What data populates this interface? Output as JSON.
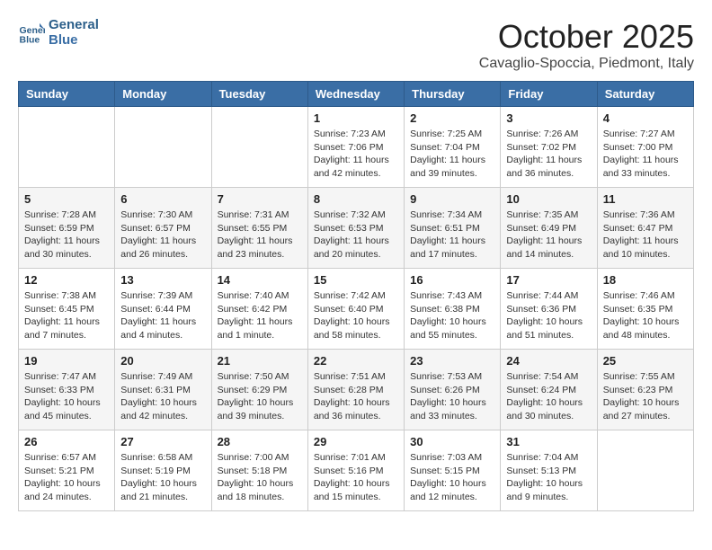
{
  "header": {
    "logo_line1": "General",
    "logo_line2": "Blue",
    "month_title": "October 2025",
    "location": "Cavaglio-Spoccia, Piedmont, Italy"
  },
  "weekdays": [
    "Sunday",
    "Monday",
    "Tuesday",
    "Wednesday",
    "Thursday",
    "Friday",
    "Saturday"
  ],
  "weeks": [
    [
      {
        "day": "",
        "info": ""
      },
      {
        "day": "",
        "info": ""
      },
      {
        "day": "",
        "info": ""
      },
      {
        "day": "1",
        "info": "Sunrise: 7:23 AM\nSunset: 7:06 PM\nDaylight: 11 hours\nand 42 minutes."
      },
      {
        "day": "2",
        "info": "Sunrise: 7:25 AM\nSunset: 7:04 PM\nDaylight: 11 hours\nand 39 minutes."
      },
      {
        "day": "3",
        "info": "Sunrise: 7:26 AM\nSunset: 7:02 PM\nDaylight: 11 hours\nand 36 minutes."
      },
      {
        "day": "4",
        "info": "Sunrise: 7:27 AM\nSunset: 7:00 PM\nDaylight: 11 hours\nand 33 minutes."
      }
    ],
    [
      {
        "day": "5",
        "info": "Sunrise: 7:28 AM\nSunset: 6:59 PM\nDaylight: 11 hours\nand 30 minutes."
      },
      {
        "day": "6",
        "info": "Sunrise: 7:30 AM\nSunset: 6:57 PM\nDaylight: 11 hours\nand 26 minutes."
      },
      {
        "day": "7",
        "info": "Sunrise: 7:31 AM\nSunset: 6:55 PM\nDaylight: 11 hours\nand 23 minutes."
      },
      {
        "day": "8",
        "info": "Sunrise: 7:32 AM\nSunset: 6:53 PM\nDaylight: 11 hours\nand 20 minutes."
      },
      {
        "day": "9",
        "info": "Sunrise: 7:34 AM\nSunset: 6:51 PM\nDaylight: 11 hours\nand 17 minutes."
      },
      {
        "day": "10",
        "info": "Sunrise: 7:35 AM\nSunset: 6:49 PM\nDaylight: 11 hours\nand 14 minutes."
      },
      {
        "day": "11",
        "info": "Sunrise: 7:36 AM\nSunset: 6:47 PM\nDaylight: 11 hours\nand 10 minutes."
      }
    ],
    [
      {
        "day": "12",
        "info": "Sunrise: 7:38 AM\nSunset: 6:45 PM\nDaylight: 11 hours\nand 7 minutes."
      },
      {
        "day": "13",
        "info": "Sunrise: 7:39 AM\nSunset: 6:44 PM\nDaylight: 11 hours\nand 4 minutes."
      },
      {
        "day": "14",
        "info": "Sunrise: 7:40 AM\nSunset: 6:42 PM\nDaylight: 11 hours\nand 1 minute."
      },
      {
        "day": "15",
        "info": "Sunrise: 7:42 AM\nSunset: 6:40 PM\nDaylight: 10 hours\nand 58 minutes."
      },
      {
        "day": "16",
        "info": "Sunrise: 7:43 AM\nSunset: 6:38 PM\nDaylight: 10 hours\nand 55 minutes."
      },
      {
        "day": "17",
        "info": "Sunrise: 7:44 AM\nSunset: 6:36 PM\nDaylight: 10 hours\nand 51 minutes."
      },
      {
        "day": "18",
        "info": "Sunrise: 7:46 AM\nSunset: 6:35 PM\nDaylight: 10 hours\nand 48 minutes."
      }
    ],
    [
      {
        "day": "19",
        "info": "Sunrise: 7:47 AM\nSunset: 6:33 PM\nDaylight: 10 hours\nand 45 minutes."
      },
      {
        "day": "20",
        "info": "Sunrise: 7:49 AM\nSunset: 6:31 PM\nDaylight: 10 hours\nand 42 minutes."
      },
      {
        "day": "21",
        "info": "Sunrise: 7:50 AM\nSunset: 6:29 PM\nDaylight: 10 hours\nand 39 minutes."
      },
      {
        "day": "22",
        "info": "Sunrise: 7:51 AM\nSunset: 6:28 PM\nDaylight: 10 hours\nand 36 minutes."
      },
      {
        "day": "23",
        "info": "Sunrise: 7:53 AM\nSunset: 6:26 PM\nDaylight: 10 hours\nand 33 minutes."
      },
      {
        "day": "24",
        "info": "Sunrise: 7:54 AM\nSunset: 6:24 PM\nDaylight: 10 hours\nand 30 minutes."
      },
      {
        "day": "25",
        "info": "Sunrise: 7:55 AM\nSunset: 6:23 PM\nDaylight: 10 hours\nand 27 minutes."
      }
    ],
    [
      {
        "day": "26",
        "info": "Sunrise: 6:57 AM\nSunset: 5:21 PM\nDaylight: 10 hours\nand 24 minutes."
      },
      {
        "day": "27",
        "info": "Sunrise: 6:58 AM\nSunset: 5:19 PM\nDaylight: 10 hours\nand 21 minutes."
      },
      {
        "day": "28",
        "info": "Sunrise: 7:00 AM\nSunset: 5:18 PM\nDaylight: 10 hours\nand 18 minutes."
      },
      {
        "day": "29",
        "info": "Sunrise: 7:01 AM\nSunset: 5:16 PM\nDaylight: 10 hours\nand 15 minutes."
      },
      {
        "day": "30",
        "info": "Sunrise: 7:03 AM\nSunset: 5:15 PM\nDaylight: 10 hours\nand 12 minutes."
      },
      {
        "day": "31",
        "info": "Sunrise: 7:04 AM\nSunset: 5:13 PM\nDaylight: 10 hours\nand 9 minutes."
      },
      {
        "day": "",
        "info": ""
      }
    ]
  ]
}
